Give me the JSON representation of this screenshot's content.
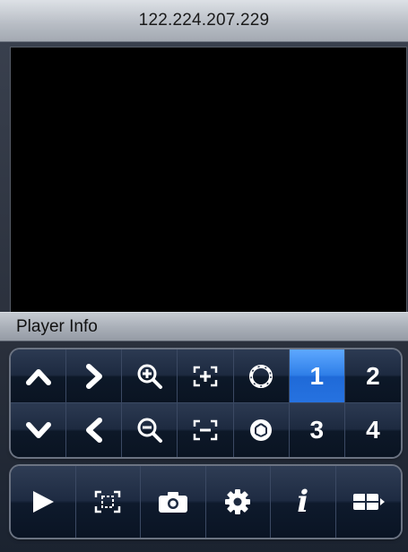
{
  "header": {
    "title": "122.224.207.229"
  },
  "info": {
    "label": "Player Info"
  },
  "ptz": {
    "channels": [
      "1",
      "2",
      "3",
      "4"
    ],
    "selected_channel": "1"
  },
  "icons": {
    "up": "chevron-up-icon",
    "right": "chevron-right-icon",
    "down": "chevron-down-icon",
    "left": "chevron-left-icon",
    "zoom_in": "zoom-in-icon",
    "zoom_out": "zoom-out-icon",
    "focus_near": "focus-in-icon",
    "focus_far": "focus-out-icon",
    "iris_open": "iris-open-icon",
    "iris_close": "iris-close-icon",
    "play": "play-icon",
    "fullscreen": "fullscreen-icon",
    "snapshot": "camera-icon",
    "settings": "gear-icon",
    "info": "info-icon",
    "layout": "layout-grid-icon"
  },
  "toolbar": {
    "info_glyph": "i"
  },
  "colors": {
    "active": "#2f7fe8",
    "panel": "#1d2a40"
  }
}
